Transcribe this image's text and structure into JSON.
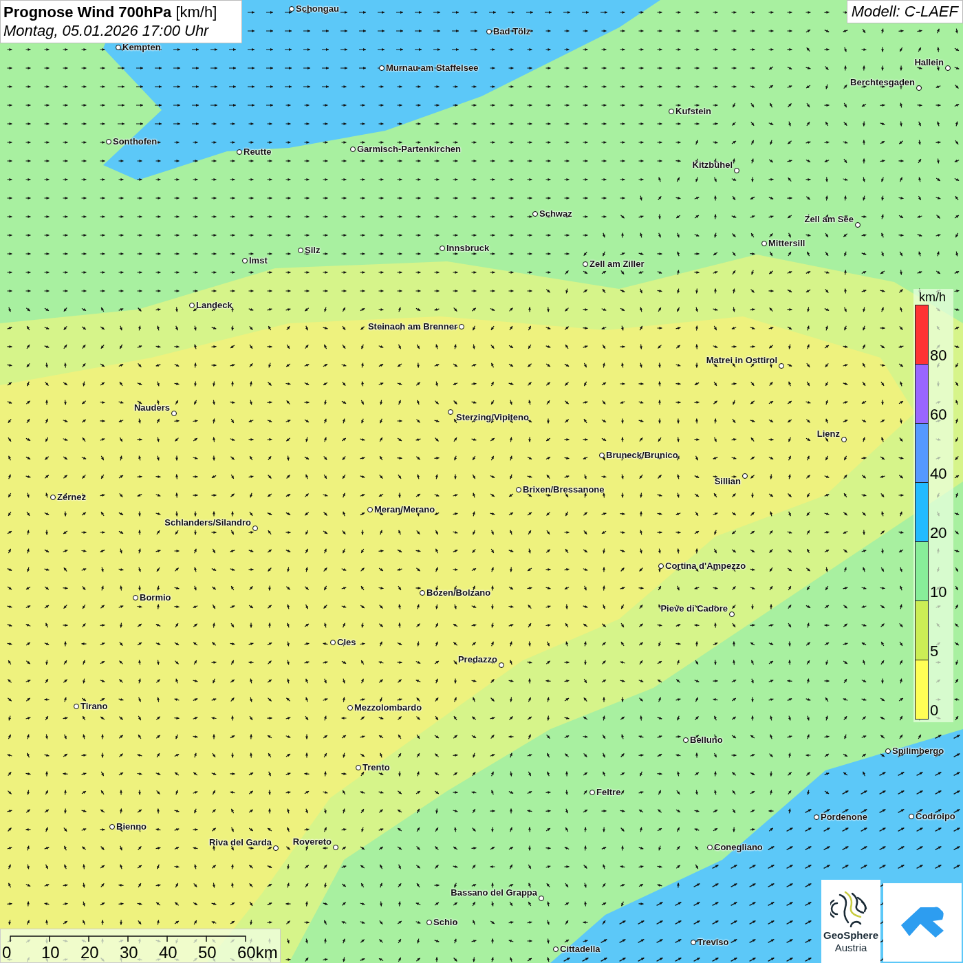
{
  "header": {
    "title": "**Prognose Wind 700hPa** [km/h]",
    "subtitle": "Montag, 05.01.2026 17:00 Uhr"
  },
  "model": "Modell: C-LAEF",
  "cities": [
    {
      "name": "Schongau"
    },
    {
      "name": "Bad Tölz"
    },
    {
      "name": "Kempten"
    },
    {
      "name": "Murnau am Staffelsee"
    },
    {
      "name": "Hallein"
    },
    {
      "name": "Berchtesgaden"
    },
    {
      "name": "Kufstein"
    },
    {
      "name": "Sonthofen"
    },
    {
      "name": "Reutte"
    },
    {
      "name": "Garmisch-Partenkirchen"
    },
    {
      "name": "Kitzbühel"
    },
    {
      "name": "Schwaz"
    },
    {
      "name": "Zell am See"
    },
    {
      "name": "Mittersill"
    },
    {
      "name": "Silz"
    },
    {
      "name": "Innsbruck"
    },
    {
      "name": "Imst"
    },
    {
      "name": "Zell am Ziller"
    },
    {
      "name": "Landeck"
    },
    {
      "name": "Steinach am Brenner"
    },
    {
      "name": "Matrei in Osttirol"
    },
    {
      "name": "Nauders"
    },
    {
      "name": "Sterzing/Vipiteno"
    },
    {
      "name": "Lienz"
    },
    {
      "name": "Bruneck/Brunico"
    },
    {
      "name": "Sillian"
    },
    {
      "name": "Brixen/Bressanone"
    },
    {
      "name": "Zernez"
    },
    {
      "name": "Meran/Merano"
    },
    {
      "name": "Schlanders/Silandro"
    },
    {
      "name": "Cortina d'Ampezzo"
    },
    {
      "name": "Bozen/Bolzano"
    },
    {
      "name": "Bormio"
    },
    {
      "name": "Pieve di Cadore"
    },
    {
      "name": "Cles"
    },
    {
      "name": "Predazzo"
    },
    {
      "name": "Tirano"
    },
    {
      "name": "Mezzolombardo"
    },
    {
      "name": "Belluno"
    },
    {
      "name": "Spilimbergo"
    },
    {
      "name": "Trento"
    },
    {
      "name": "Feltre"
    },
    {
      "name": "Pordenone"
    },
    {
      "name": "Codroipo"
    },
    {
      "name": "Bienno"
    },
    {
      "name": "Riva del Garda"
    },
    {
      "name": "Rovereto"
    },
    {
      "name": "Conegliano"
    },
    {
      "name": "Bassano del Grappa"
    },
    {
      "name": "Schio"
    },
    {
      "name": "Treviso"
    },
    {
      "name": "Cittadella"
    }
  ],
  "legend": {
    "unit": "km/h",
    "bands": [
      {
        "color": "#ff3333",
        "label": "80"
      },
      {
        "color": "#9966ff",
        "label": "60"
      },
      {
        "color": "#5599ff",
        "label": "40"
      },
      {
        "color": "#22bbff",
        "label": "20"
      },
      {
        "color": "#88ee99",
        "label": "10"
      },
      {
        "color": "#ccee55",
        "label": "5"
      },
      {
        "color": "#ffff55",
        "label": "0"
      }
    ]
  },
  "scale_bar": {
    "ticks": [
      "0",
      "10",
      "20",
      "30",
      "40",
      "50",
      "60km"
    ]
  },
  "logos": {
    "brand": "GeoSphere",
    "country": "Austria"
  }
}
